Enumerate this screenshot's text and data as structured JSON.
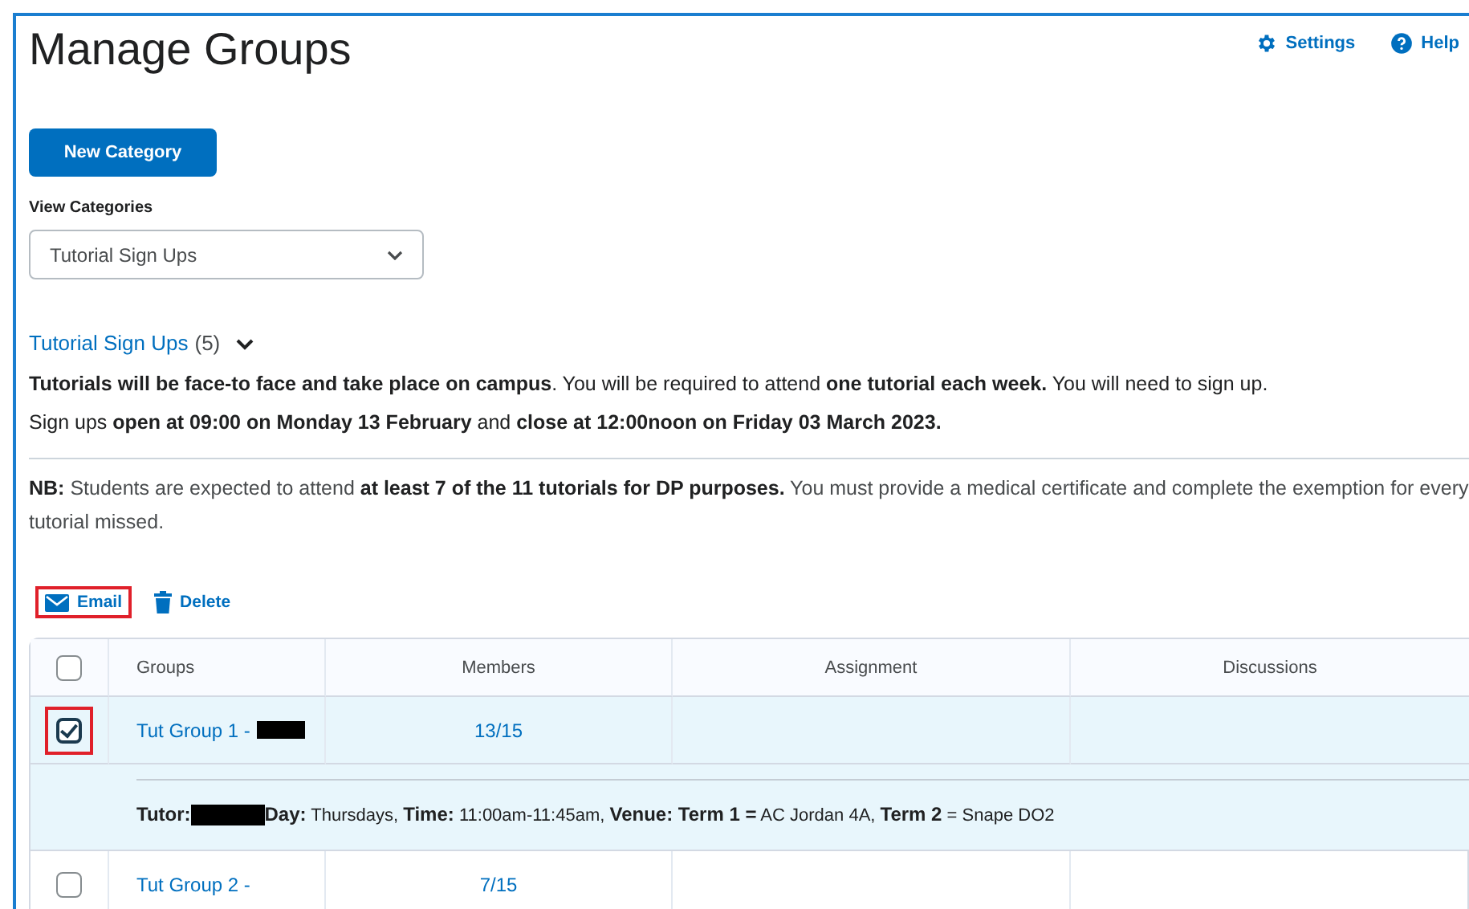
{
  "page": {
    "title": "Manage Groups",
    "header_links": [
      {
        "kind": "settings",
        "label": "Settings"
      },
      {
        "kind": "help",
        "label": "Help"
      }
    ]
  },
  "new_category_button": "New Category",
  "view_categories": {
    "label": "View Categories",
    "value": "Tutorial Sign Ups"
  },
  "category": {
    "name": "Tutorial Sign Ups",
    "count": "(5)",
    "expanded": true,
    "description": "**Tutorials will be face-to face and take place on campus**. You will be required to attend **one tutorial each week.** You will need to sign up. Sign ups **open at 09:00 on Monday 13 February** and **close at 12:00noon on Friday 03 March 2023.**",
    "note": "**NB:**  Students are expected to attend **at least 7 of the 11 tutorials for DP purposes.** You must provide a medical certificate and complete the exemption for every tutorial missed."
  },
  "actions": [
    {
      "kind": "email",
      "label": "Email",
      "highlighted": true
    },
    {
      "kind": "delete",
      "label": "Delete",
      "highlighted": false
    }
  ],
  "table": {
    "select_all_checked": false,
    "columns": [
      "Groups",
      "Members",
      "Assignment",
      "Discussions"
    ],
    "rows": [
      {
        "group": "Tut Group 1 -",
        "redacted": true,
        "members": "13/15",
        "checked": true,
        "highlighted": true,
        "details": "**Tutor:** ",
        "details_after": " **Day:** Thursdays, **Time:** 11:00am-11:45am, **Venue: Term 1 =** AC Jordan 4A, **Term 2** = Snape DO2"
      },
      {
        "group": "Tut Group 2 -",
        "redacted": false,
        "members": "7/15",
        "checked": false,
        "highlighted": false
      }
    ]
  }
}
